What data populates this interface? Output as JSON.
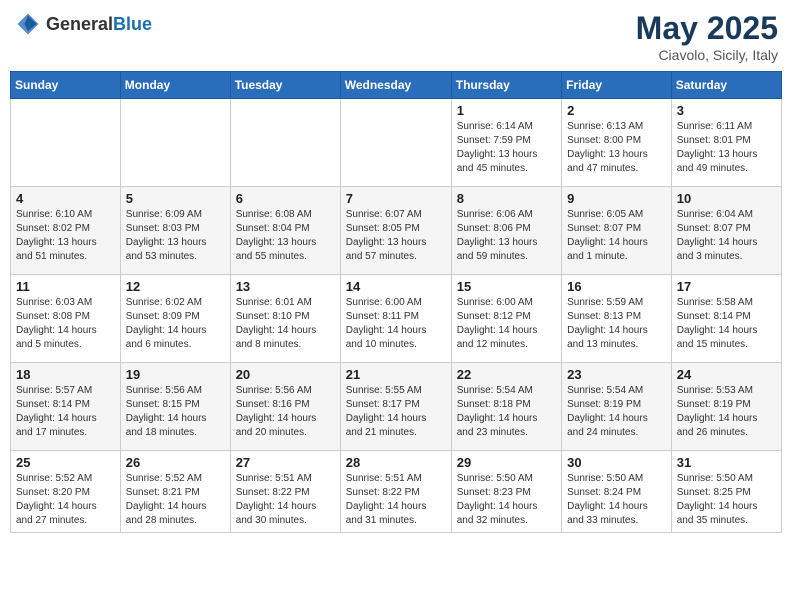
{
  "header": {
    "logo_general": "General",
    "logo_blue": "Blue",
    "month": "May 2025",
    "location": "Ciavolo, Sicily, Italy"
  },
  "days_of_week": [
    "Sunday",
    "Monday",
    "Tuesday",
    "Wednesday",
    "Thursday",
    "Friday",
    "Saturday"
  ],
  "weeks": [
    [
      {
        "day": "",
        "info": ""
      },
      {
        "day": "",
        "info": ""
      },
      {
        "day": "",
        "info": ""
      },
      {
        "day": "",
        "info": ""
      },
      {
        "day": "1",
        "info": "Sunrise: 6:14 AM\nSunset: 7:59 PM\nDaylight: 13 hours\nand 45 minutes."
      },
      {
        "day": "2",
        "info": "Sunrise: 6:13 AM\nSunset: 8:00 PM\nDaylight: 13 hours\nand 47 minutes."
      },
      {
        "day": "3",
        "info": "Sunrise: 6:11 AM\nSunset: 8:01 PM\nDaylight: 13 hours\nand 49 minutes."
      }
    ],
    [
      {
        "day": "4",
        "info": "Sunrise: 6:10 AM\nSunset: 8:02 PM\nDaylight: 13 hours\nand 51 minutes."
      },
      {
        "day": "5",
        "info": "Sunrise: 6:09 AM\nSunset: 8:03 PM\nDaylight: 13 hours\nand 53 minutes."
      },
      {
        "day": "6",
        "info": "Sunrise: 6:08 AM\nSunset: 8:04 PM\nDaylight: 13 hours\nand 55 minutes."
      },
      {
        "day": "7",
        "info": "Sunrise: 6:07 AM\nSunset: 8:05 PM\nDaylight: 13 hours\nand 57 minutes."
      },
      {
        "day": "8",
        "info": "Sunrise: 6:06 AM\nSunset: 8:06 PM\nDaylight: 13 hours\nand 59 minutes."
      },
      {
        "day": "9",
        "info": "Sunrise: 6:05 AM\nSunset: 8:07 PM\nDaylight: 14 hours\nand 1 minute."
      },
      {
        "day": "10",
        "info": "Sunrise: 6:04 AM\nSunset: 8:07 PM\nDaylight: 14 hours\nand 3 minutes."
      }
    ],
    [
      {
        "day": "11",
        "info": "Sunrise: 6:03 AM\nSunset: 8:08 PM\nDaylight: 14 hours\nand 5 minutes."
      },
      {
        "day": "12",
        "info": "Sunrise: 6:02 AM\nSunset: 8:09 PM\nDaylight: 14 hours\nand 6 minutes."
      },
      {
        "day": "13",
        "info": "Sunrise: 6:01 AM\nSunset: 8:10 PM\nDaylight: 14 hours\nand 8 minutes."
      },
      {
        "day": "14",
        "info": "Sunrise: 6:00 AM\nSunset: 8:11 PM\nDaylight: 14 hours\nand 10 minutes."
      },
      {
        "day": "15",
        "info": "Sunrise: 6:00 AM\nSunset: 8:12 PM\nDaylight: 14 hours\nand 12 minutes."
      },
      {
        "day": "16",
        "info": "Sunrise: 5:59 AM\nSunset: 8:13 PM\nDaylight: 14 hours\nand 13 minutes."
      },
      {
        "day": "17",
        "info": "Sunrise: 5:58 AM\nSunset: 8:14 PM\nDaylight: 14 hours\nand 15 minutes."
      }
    ],
    [
      {
        "day": "18",
        "info": "Sunrise: 5:57 AM\nSunset: 8:14 PM\nDaylight: 14 hours\nand 17 minutes."
      },
      {
        "day": "19",
        "info": "Sunrise: 5:56 AM\nSunset: 8:15 PM\nDaylight: 14 hours\nand 18 minutes."
      },
      {
        "day": "20",
        "info": "Sunrise: 5:56 AM\nSunset: 8:16 PM\nDaylight: 14 hours\nand 20 minutes."
      },
      {
        "day": "21",
        "info": "Sunrise: 5:55 AM\nSunset: 8:17 PM\nDaylight: 14 hours\nand 21 minutes."
      },
      {
        "day": "22",
        "info": "Sunrise: 5:54 AM\nSunset: 8:18 PM\nDaylight: 14 hours\nand 23 minutes."
      },
      {
        "day": "23",
        "info": "Sunrise: 5:54 AM\nSunset: 8:19 PM\nDaylight: 14 hours\nand 24 minutes."
      },
      {
        "day": "24",
        "info": "Sunrise: 5:53 AM\nSunset: 8:19 PM\nDaylight: 14 hours\nand 26 minutes."
      }
    ],
    [
      {
        "day": "25",
        "info": "Sunrise: 5:52 AM\nSunset: 8:20 PM\nDaylight: 14 hours\nand 27 minutes."
      },
      {
        "day": "26",
        "info": "Sunrise: 5:52 AM\nSunset: 8:21 PM\nDaylight: 14 hours\nand 28 minutes."
      },
      {
        "day": "27",
        "info": "Sunrise: 5:51 AM\nSunset: 8:22 PM\nDaylight: 14 hours\nand 30 minutes."
      },
      {
        "day": "28",
        "info": "Sunrise: 5:51 AM\nSunset: 8:22 PM\nDaylight: 14 hours\nand 31 minutes."
      },
      {
        "day": "29",
        "info": "Sunrise: 5:50 AM\nSunset: 8:23 PM\nDaylight: 14 hours\nand 32 minutes."
      },
      {
        "day": "30",
        "info": "Sunrise: 5:50 AM\nSunset: 8:24 PM\nDaylight: 14 hours\nand 33 minutes."
      },
      {
        "day": "31",
        "info": "Sunrise: 5:50 AM\nSunset: 8:25 PM\nDaylight: 14 hours\nand 35 minutes."
      }
    ]
  ]
}
